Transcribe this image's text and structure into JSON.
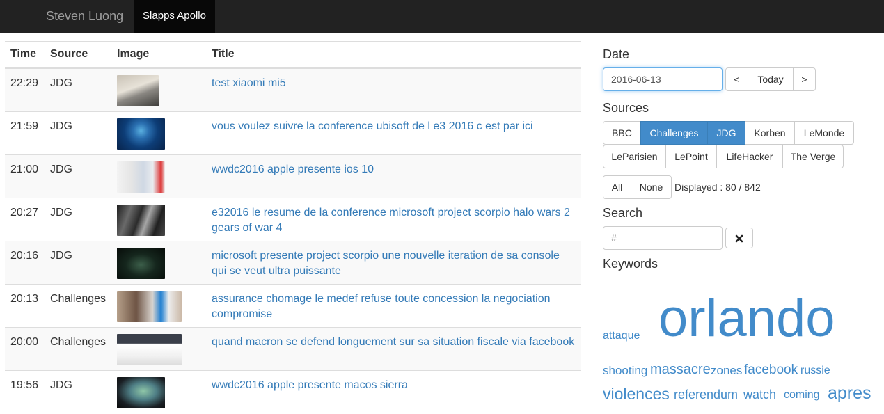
{
  "navbar": {
    "brand": "Steven Luong",
    "active_tab": "Slapps Apollo"
  },
  "table": {
    "headers": [
      "Time",
      "Source",
      "Image",
      "Title"
    ],
    "rows": [
      {
        "time": "22:29",
        "source": "JDG",
        "title": "test xiaomi mi5"
      },
      {
        "time": "21:59",
        "source": "JDG",
        "title": "vous voulez suivre la conference ubisoft de l e3 2016 c est par ici"
      },
      {
        "time": "21:00",
        "source": "JDG",
        "title": "wwdc2016 apple presente ios 10"
      },
      {
        "time": "20:27",
        "source": "JDG",
        "title": "e32016 le resume de la conference microsoft project scorpio halo wars 2 gears of war 4"
      },
      {
        "time": "20:16",
        "source": "JDG",
        "title": "microsoft presente project scorpio une nouvelle iteration de sa console qui se veut ultra puissante"
      },
      {
        "time": "20:13",
        "source": "Challenges",
        "title": "assurance chomage le medef refuse toute concession la negociation compromise"
      },
      {
        "time": "20:00",
        "source": "Challenges",
        "title": "quand macron se defend longuement sur sa situation fiscale via facebook"
      },
      {
        "time": "19:56",
        "source": "JDG",
        "title": "wwdc2016 apple presente macos sierra"
      }
    ]
  },
  "date": {
    "heading": "Date",
    "value": "2016-06-13",
    "prev_label": "<",
    "today_label": "Today",
    "next_label": ">"
  },
  "sources": {
    "heading": "Sources",
    "items": [
      "BBC",
      "Challenges",
      "JDG",
      "Korben",
      "LeMonde",
      "LeParisien",
      "LePoint",
      "LifeHacker",
      "The Verge"
    ],
    "active": [
      "Challenges",
      "JDG"
    ],
    "all_label": "All",
    "none_label": "None",
    "displayed": "Displayed : 80 / 842"
  },
  "search": {
    "heading": "Search",
    "placeholder": "#",
    "clear_icon": "close-icon"
  },
  "keywords": {
    "heading": "Keywords",
    "words": [
      "attaque",
      "orlando",
      "shooting",
      "massacre",
      "zones",
      "facebook",
      "russie",
      "violences",
      "referendum",
      "watch",
      "coming",
      "apres"
    ]
  },
  "colors": {
    "link": "#337ab7",
    "active": "#428bca",
    "navbar": "#222222"
  }
}
